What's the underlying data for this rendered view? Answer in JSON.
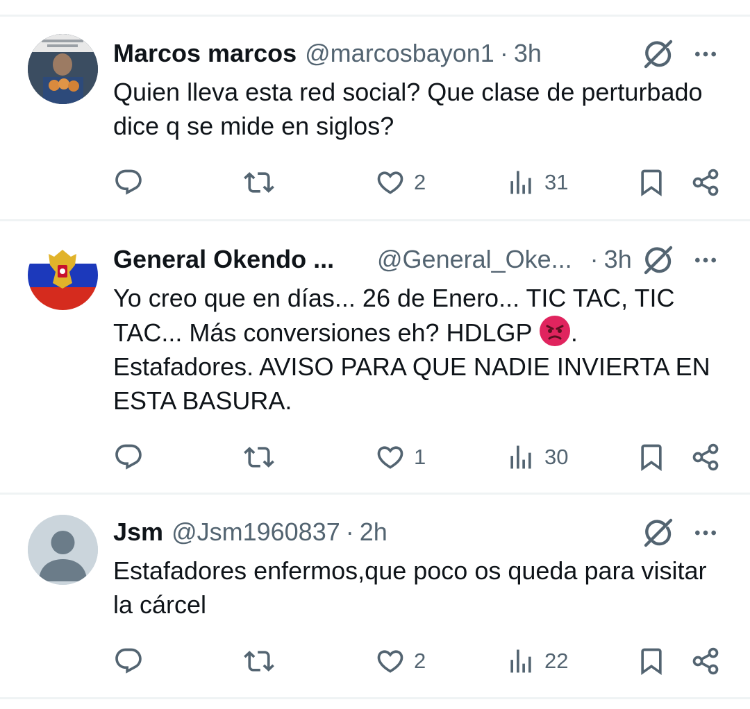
{
  "tweets": [
    {
      "name": "Marcos marcos",
      "handle": "@marcosbayon1",
      "sep": "·",
      "time": "3h",
      "text": "Quien lleva esta red social? Que clase de perturbado dice q se mide en siglos?",
      "likes": "2",
      "views": "31"
    },
    {
      "name": "General Okendo ...",
      "handle": "@General_Oke...",
      "sep": "·",
      "time": "3h",
      "text_part1": "Yo creo que en días... 26 de Enero... TIC TAC, TIC TAC... Más conversiones eh? HDLGP ",
      "text_part2": ". Estafadores. AVISO PARA QUE NADIE INVIERTA EN ESTA BASURA.",
      "likes": "1",
      "views": "30"
    },
    {
      "name": "Jsm",
      "handle": "@Jsm1960837",
      "sep": "·",
      "time": "2h",
      "text": "Estafadores enfermos,que poco os queda para visitar la cárcel",
      "likes": "2",
      "views": "22"
    }
  ],
  "icons": {
    "grok": "grok-icon",
    "more": "more-icon",
    "reply": "reply-icon",
    "retweet": "retweet-icon",
    "like": "like-icon",
    "views": "views-icon",
    "bookmark": "bookmark-icon",
    "share": "share-icon",
    "emoji": "angry-face-emoji"
  },
  "colors": {
    "text": "#0f1419",
    "secondary": "#536471",
    "divider": "#eff3f4",
    "angry": "#e0245e"
  }
}
